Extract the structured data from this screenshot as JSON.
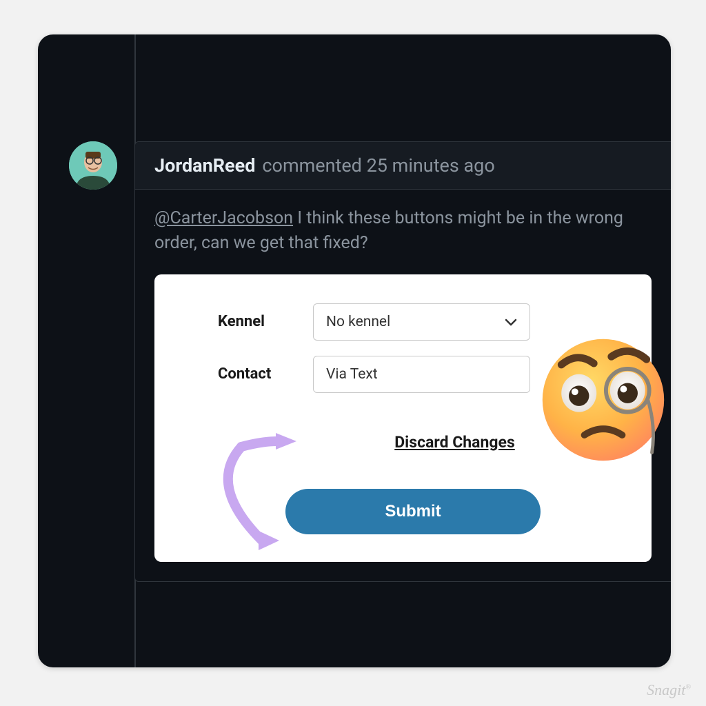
{
  "comment": {
    "author": "JordanReed",
    "action": "commented",
    "timestamp": "25 minutes ago",
    "mention": "@CarterJacobson",
    "text": " I think these buttons might be in the wrong order, can we get that fixed?"
  },
  "form": {
    "kennel_label": "Kennel",
    "kennel_value": "No kennel",
    "contact_label": "Contact",
    "contact_value": "Via Text",
    "discard_label": "Discard Changes",
    "submit_label": "Submit"
  },
  "annotation": {
    "emoji_name": "face-with-monocle",
    "arrow_name": "swap-curved-arrow"
  },
  "watermark": "Snagit"
}
